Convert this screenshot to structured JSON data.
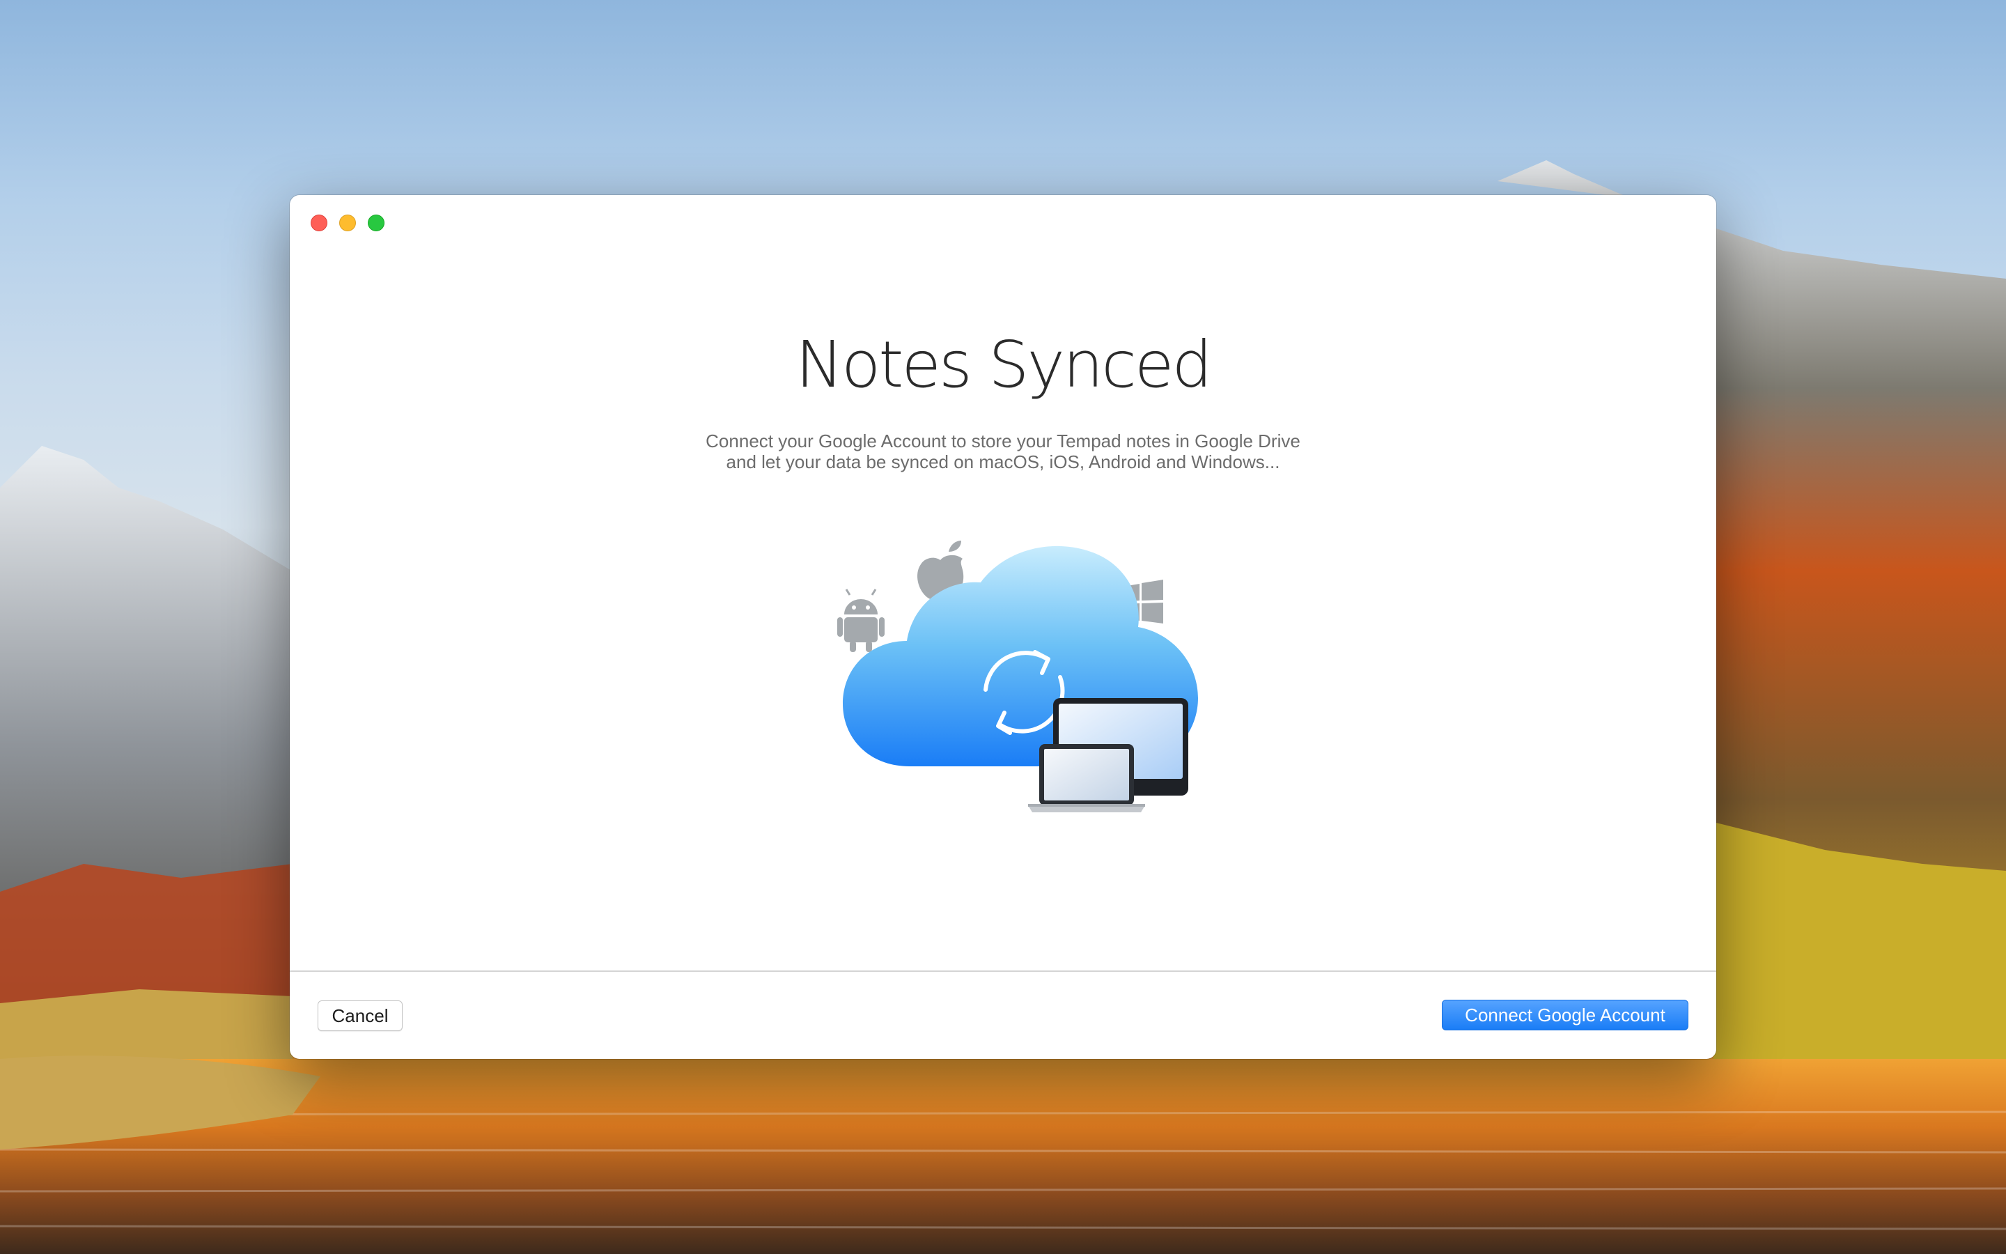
{
  "window": {
    "title": "Notes Synced",
    "description_lines": [
      "Connect your Google Account to store your Tempad notes in Google Drive",
      "and let your data be synced on macOS, iOS, Android and Windows..."
    ],
    "illustration": {
      "cloud_icon": "cloud-icon",
      "sync_icon": "sync-arrows-icon",
      "platform_icons": [
        "apple-icon",
        "android-icon",
        "windows-icon"
      ],
      "device_icons": [
        "monitor-icon",
        "laptop-icon"
      ]
    }
  },
  "traffic_lights": [
    "close",
    "minimize",
    "zoom"
  ],
  "footer": {
    "cancel_label": "Cancel",
    "connect_label": "Connect Google Account"
  },
  "colors": {
    "accent": "#1a7df6",
    "close": "#fe5f57",
    "minimize": "#febc2e",
    "zoom": "#28c840",
    "cloud_top": "#bfe6fb",
    "cloud_bottom": "#1a7df6"
  }
}
